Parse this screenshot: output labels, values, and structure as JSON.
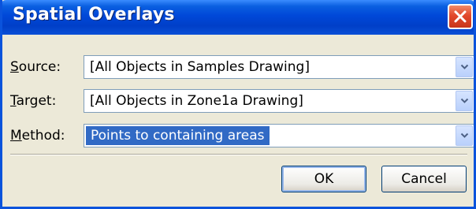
{
  "window": {
    "title": "Spatial Overlays"
  },
  "fields": {
    "source": {
      "label_access": "S",
      "label_rest": "ource:",
      "value": "[All Objects in Samples Drawing]"
    },
    "target": {
      "label_access": "T",
      "label_rest": "arget:",
      "value": "[All Objects in Zone1a Drawing]"
    },
    "method": {
      "label_access": "M",
      "label_rest": "ethod:",
      "value": "Points to containing areas"
    }
  },
  "buttons": {
    "ok": "OK",
    "cancel": "Cancel"
  },
  "icons": {
    "close": "close-icon",
    "dropdown": "chevron-down-icon"
  },
  "colors": {
    "titlebar": "#0048d8",
    "close": "#e2482c",
    "selection": "#316ac5"
  }
}
